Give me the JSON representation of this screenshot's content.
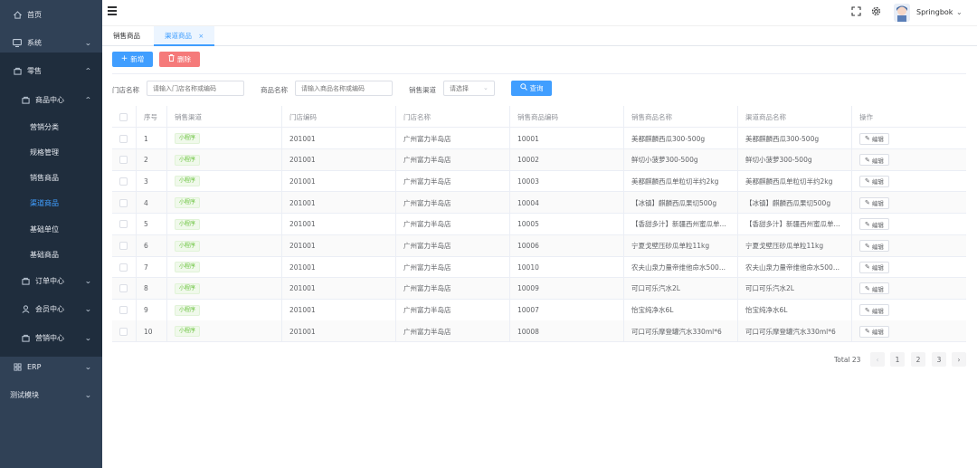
{
  "sidebar": {
    "items": [
      {
        "label": "首页",
        "icon": "home-icon"
      },
      {
        "label": "系统",
        "icon": "monitor-icon"
      },
      {
        "label": "零售",
        "icon": "shop-icon"
      },
      {
        "label": "商品中心",
        "icon": "shop-icon"
      },
      {
        "label": "营销分类"
      },
      {
        "label": "规格管理"
      },
      {
        "label": "销售商品"
      },
      {
        "label": "渠道商品"
      },
      {
        "label": "基础单位"
      },
      {
        "label": "基础商品"
      },
      {
        "label": "订单中心",
        "icon": "shop-icon"
      },
      {
        "label": "会员中心",
        "icon": "user-icon"
      },
      {
        "label": "营销中心",
        "icon": "shop-icon"
      },
      {
        "label": "ERP",
        "icon": "grid-icon"
      },
      {
        "label": "测试模块"
      }
    ]
  },
  "header": {
    "username": "Springbok"
  },
  "tabs": [
    {
      "label": "销售商品"
    },
    {
      "label": "渠道商品",
      "close": "×"
    }
  ],
  "toolbar": {
    "add_label": "新增",
    "delete_label": "删除"
  },
  "filters": {
    "store_label": "门店名称",
    "store_placeholder": "请输入门店名称或编码",
    "product_label": "商品名称",
    "product_placeholder": "请输入商品名称或编码",
    "channel_label": "销售渠道",
    "channel_placeholder": "请选择",
    "query_label": "查询"
  },
  "table": {
    "headers": [
      "序号",
      "销售渠道",
      "门店编码",
      "门店名称",
      "销售商品编码",
      "销售商品名称",
      "渠道商品名称",
      "操作"
    ],
    "edit_label": "编辑",
    "rows": [
      {
        "no": "1",
        "channel": "小程序",
        "store_code": "201001",
        "store_name": "广州富力半岛店",
        "sku": "10001",
        "name": "美都麒麟西瓜300-500g",
        "channel_name": "美都麒麟西瓜300-500g"
      },
      {
        "no": "2",
        "channel": "小程序",
        "store_code": "201001",
        "store_name": "广州富力半岛店",
        "sku": "10002",
        "name": "鲜切小菠萝300-500g",
        "channel_name": "鲜切小菠萝300-500g"
      },
      {
        "no": "3",
        "channel": "小程序",
        "store_code": "201001",
        "store_name": "广州富力半岛店",
        "sku": "10003",
        "name": "美都麒麟西瓜单粒切半约2kg",
        "channel_name": "美都麒麟西瓜单粒切半约2kg"
      },
      {
        "no": "4",
        "channel": "小程序",
        "store_code": "201001",
        "store_name": "广州富力半岛店",
        "sku": "10004",
        "name": "【冰镇】麒麟西瓜果切500g",
        "channel_name": "【冰镇】麒麟西瓜果切500g"
      },
      {
        "no": "5",
        "channel": "小程序",
        "store_code": "201001",
        "store_name": "广州富力半岛店",
        "sku": "10005",
        "name": "【香甜多汁】新疆西州蜜瓜单...",
        "channel_name": "【香甜多汁】新疆西州蜜瓜单..."
      },
      {
        "no": "6",
        "channel": "小程序",
        "store_code": "201001",
        "store_name": "广州富力半岛店",
        "sku": "10006",
        "name": "宁夏戈壁压砂瓜单粒11kg",
        "channel_name": "宁夏戈壁压砂瓜单粒11kg"
      },
      {
        "no": "7",
        "channel": "小程序",
        "store_code": "201001",
        "store_name": "广州富力半岛店",
        "sku": "10010",
        "name": "农夫山泉力量帝维他命水500...",
        "channel_name": "农夫山泉力量帝维他命水500..."
      },
      {
        "no": "8",
        "channel": "小程序",
        "store_code": "201001",
        "store_name": "广州富力半岛店",
        "sku": "10009",
        "name": "可口可乐汽水2L",
        "channel_name": "可口可乐汽水2L"
      },
      {
        "no": "9",
        "channel": "小程序",
        "store_code": "201001",
        "store_name": "广州富力半岛店",
        "sku": "10007",
        "name": "怡宝纯净水6L",
        "channel_name": "怡宝纯净水6L"
      },
      {
        "no": "10",
        "channel": "小程序",
        "store_code": "201001",
        "store_name": "广州富力半岛店",
        "sku": "10008",
        "name": "可口可乐摩登罐汽水330ml*6",
        "channel_name": "可口可乐摩登罐汽水330ml*6"
      }
    ]
  },
  "pagination": {
    "total": "Total 23",
    "prev": "‹",
    "next": "›",
    "pages": [
      "1",
      "2",
      "3"
    ]
  },
  "colors": {
    "sidebar_bg": "#304156",
    "primary": "#409eff",
    "danger": "#f56c6c",
    "success": "#67c23a"
  }
}
